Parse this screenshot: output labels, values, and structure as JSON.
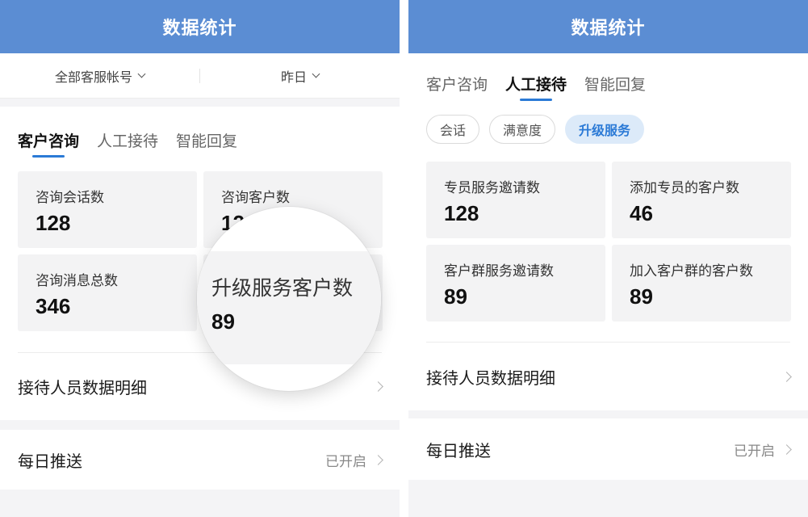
{
  "left": {
    "title": "数据统计",
    "filters": [
      {
        "label": "全部客服帐号"
      },
      {
        "label": "昨日"
      }
    ],
    "tabs": [
      {
        "label": "客户咨询",
        "active": true
      },
      {
        "label": "人工接待",
        "active": false
      },
      {
        "label": "智能回复",
        "active": false
      }
    ],
    "stats": [
      {
        "label": "咨询会话数",
        "value": "128"
      },
      {
        "label": "咨询客户数",
        "value": "12"
      },
      {
        "label": "咨询消息总数",
        "value": "346"
      }
    ],
    "magnifier": {
      "label": "升级服务客户数",
      "value": "89"
    },
    "detail_row": {
      "label": "接待人员数据明细"
    },
    "push_row": {
      "label": "每日推送",
      "status": "已开启"
    }
  },
  "right": {
    "title": "数据统计",
    "tabs": [
      {
        "label": "客户咨询",
        "active": false
      },
      {
        "label": "人工接待",
        "active": true
      },
      {
        "label": "智能回复",
        "active": false
      }
    ],
    "pills": [
      {
        "label": "会话",
        "active": false
      },
      {
        "label": "满意度",
        "active": false
      },
      {
        "label": "升级服务",
        "active": true
      }
    ],
    "stats": [
      {
        "label": "专员服务邀请数",
        "value": "128"
      },
      {
        "label": "添加专员的客户数",
        "value": "46"
      },
      {
        "label": "客户群服务邀请数",
        "value": "89"
      },
      {
        "label": "加入客户群的客户数",
        "value": "89"
      }
    ],
    "detail_row": {
      "label": "接待人员数据明细"
    },
    "push_row": {
      "label": "每日推送",
      "status": "已开启"
    }
  },
  "colors": {
    "header": "#5b8dd3",
    "accent": "#2b7ad6",
    "pill_active_bg": "#dceaf9",
    "page_bg": "#f4f4f6"
  }
}
